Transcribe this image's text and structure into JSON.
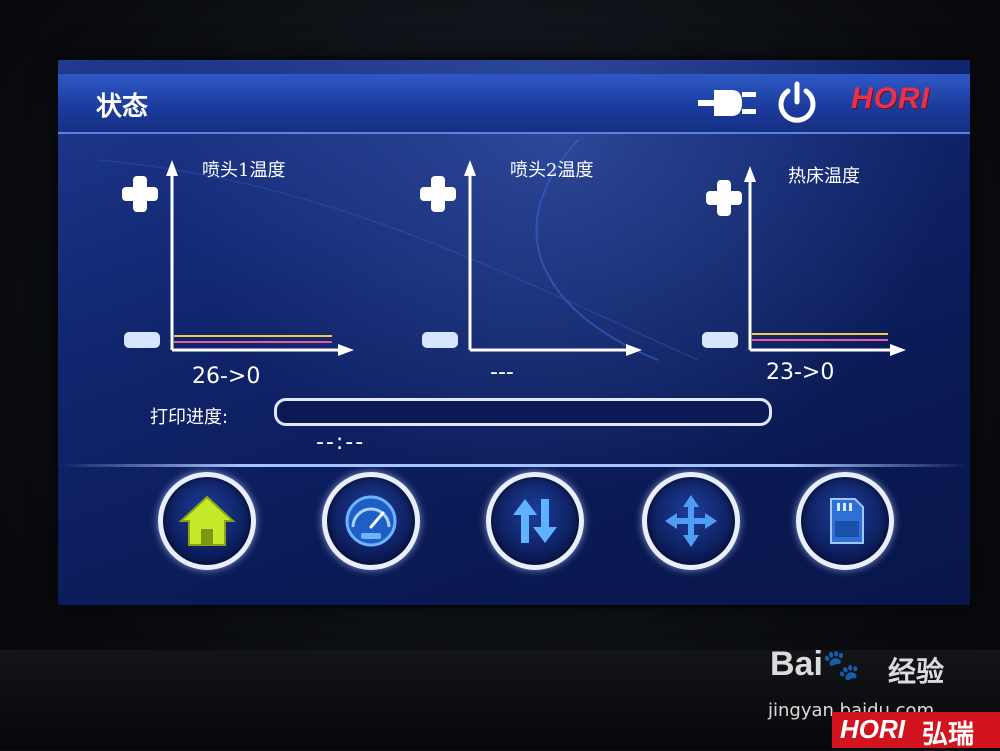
{
  "header": {
    "title": "状态",
    "brand": "HORI"
  },
  "charts": [
    {
      "title": "喷头1温度",
      "value": "26->0"
    },
    {
      "title": "喷头2温度",
      "value": "---"
    },
    {
      "title": "热床温度",
      "value": "23->0"
    }
  ],
  "progress": {
    "label": "打印进度:",
    "percent": 0,
    "time": "--:--"
  },
  "nav": [
    {
      "icon": "home-icon"
    },
    {
      "icon": "speedometer-icon"
    },
    {
      "icon": "up-down-arrows-icon"
    },
    {
      "icon": "move-axes-icon"
    },
    {
      "icon": "sd-card-icon"
    }
  ],
  "watermark": {
    "baidu": "Bai",
    "jingyan": "经验",
    "url": "jingyan.baidu.com",
    "brand_en": "HORI",
    "brand_cn": "弘瑞"
  },
  "colors": {
    "screen": "#11256e",
    "topbar": "#1a3b9c",
    "brand": "#e8314a",
    "line_yellow": "#f2c84b",
    "line_pink": "#e85aa0"
  }
}
